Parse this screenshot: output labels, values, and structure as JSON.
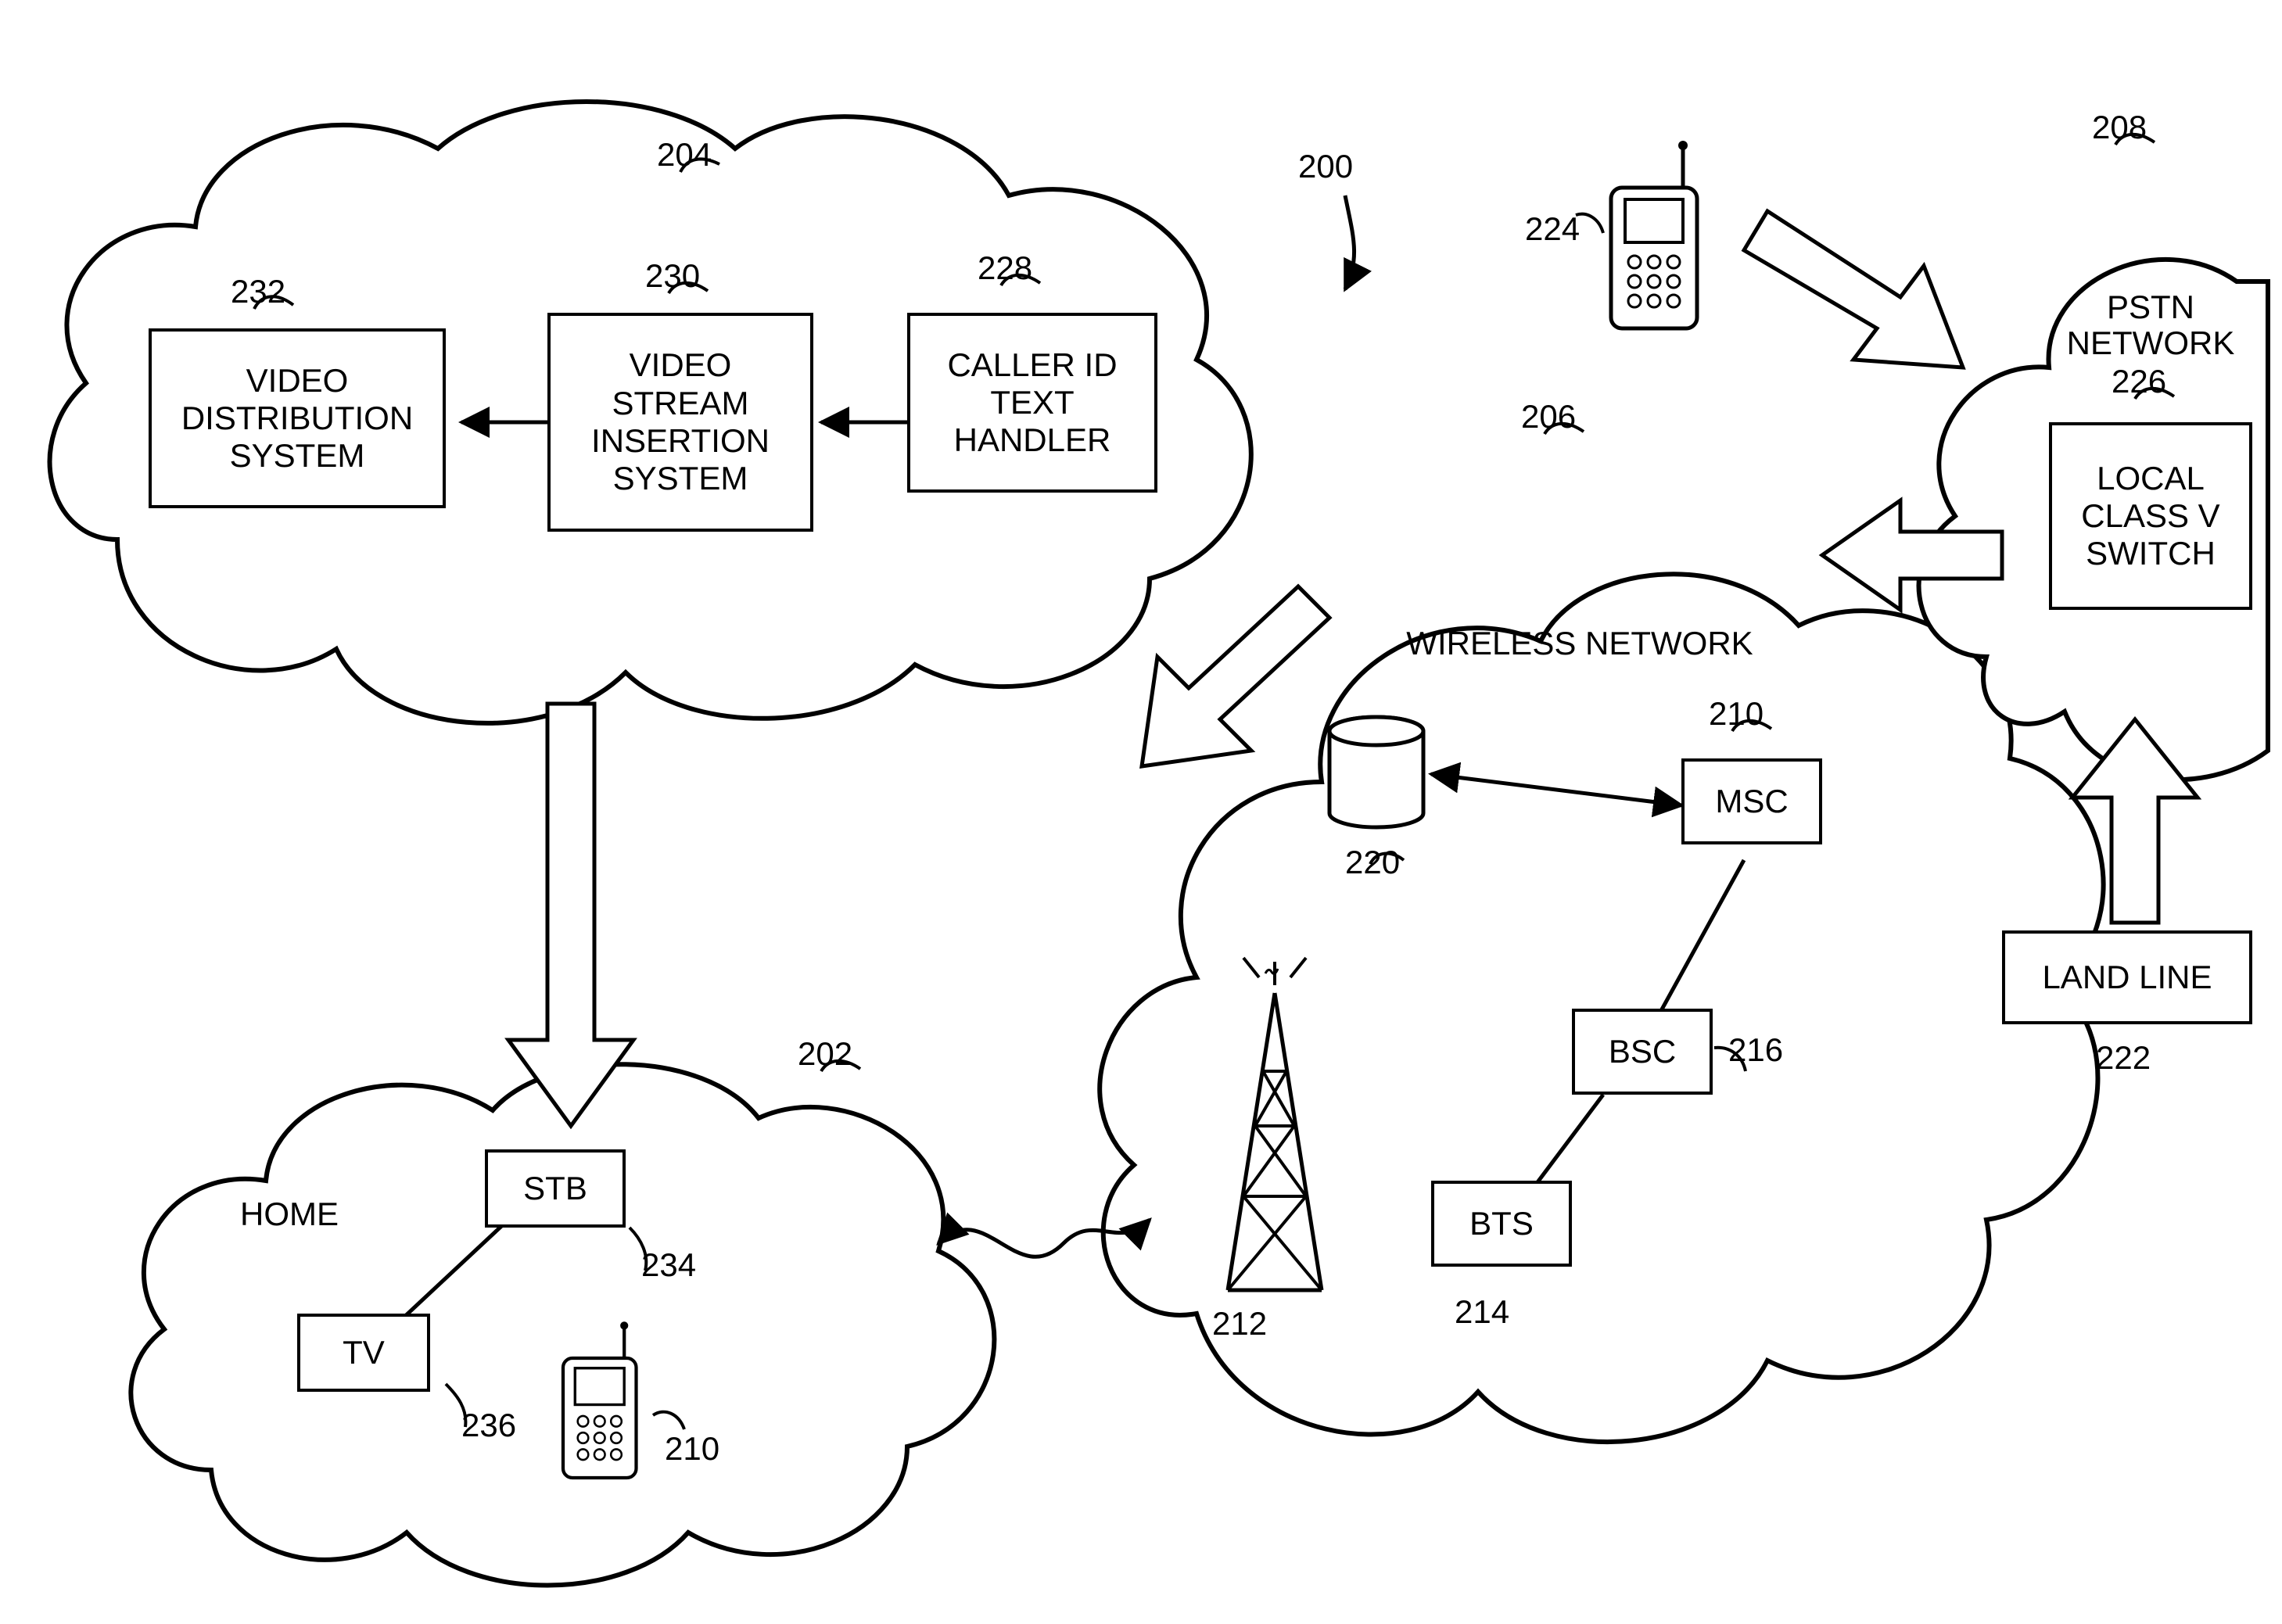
{
  "figure_ref": "200",
  "clouds": {
    "video_cloud": {
      "ref": "204"
    },
    "wireless_cloud": {
      "ref": "206",
      "title": "WIRELESS NETWORK"
    },
    "pstn_cloud": {
      "ref": "208",
      "title": "PSTN NETWORK"
    },
    "home_cloud": {
      "ref": "202",
      "title": "HOME"
    }
  },
  "nodes": {
    "video_distribution": {
      "ref": "232",
      "label": "VIDEO\nDISTRIBUTION\nSYSTEM"
    },
    "video_stream_insertion": {
      "ref": "230",
      "label": "VIDEO\nSTREAM\nINSERTION\nSYSTEM"
    },
    "caller_id_handler": {
      "ref": "228",
      "label": "CALLER ID\nTEXT\nHANDLER"
    },
    "local_switch": {
      "ref": "226",
      "label": "LOCAL\nCLASS V\nSWITCH"
    },
    "land_line": {
      "ref": "222",
      "label": "LAND LINE"
    },
    "msc": {
      "ref": "210",
      "label": "MSC"
    },
    "bsc": {
      "ref": "216",
      "label": "BSC"
    },
    "bts": {
      "ref": "214",
      "label": "BTS"
    },
    "hlr": {
      "ref": "220"
    },
    "tower": {
      "ref": "212"
    },
    "stb": {
      "ref": "234",
      "label": "STB"
    },
    "tv": {
      "ref": "236",
      "label": "TV"
    },
    "home_phone": {
      "ref": "210"
    },
    "pstn_phone": {
      "ref": "224"
    }
  }
}
